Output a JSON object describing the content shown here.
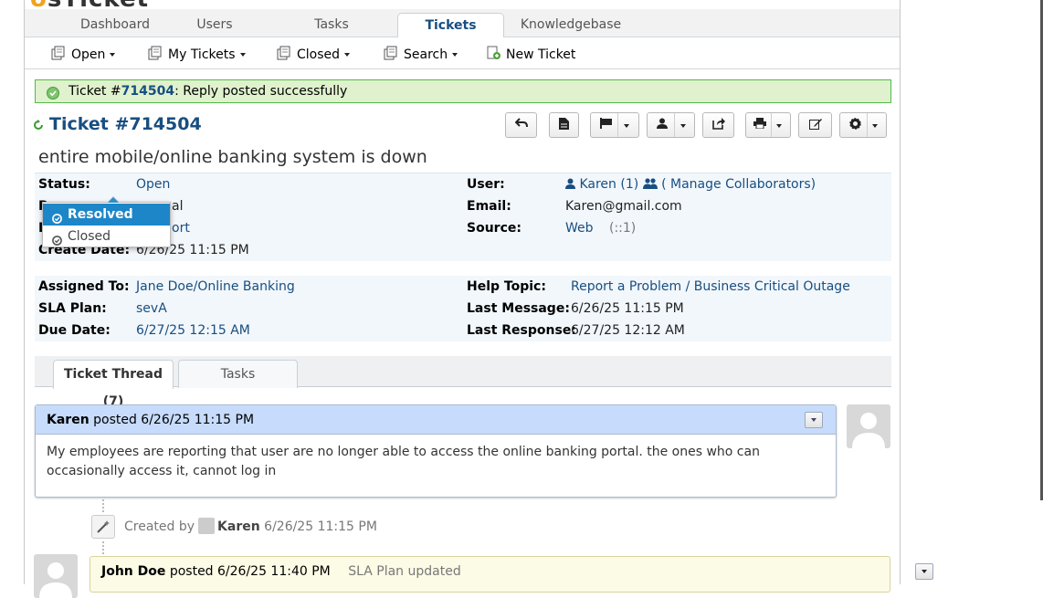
{
  "nav": {
    "tabs": [
      "Dashboard",
      "Users",
      "Tasks",
      "Tickets",
      "Knowledgebase"
    ],
    "active": "Tickets"
  },
  "subnav": {
    "open": "Open",
    "my_tickets": "My Tickets",
    "closed": "Closed",
    "search": "Search",
    "new_ticket": "New Ticket"
  },
  "notice": {
    "prefix": "Ticket #",
    "number": "714504",
    "message": ": Reply posted successfully"
  },
  "ticket": {
    "title": "Ticket #714504",
    "subject": "entire mobile/online banking system is down"
  },
  "info": {
    "status_label": "Status:",
    "status_value": "Open",
    "priority_fragment": "al",
    "dept_fragment": "ort",
    "create_label": "Create Date:",
    "create_value": "6/26/25 11:15 PM",
    "user_label": "User:",
    "user_name": "Karen",
    "user_count": "(1)",
    "manage": "( Manage Collaborators)",
    "email_label": "Email:",
    "email_value": "Karen@gmail.com",
    "source_label": "Source:",
    "source_value": "Web",
    "source_extra": "(::1)",
    "assigned_label": "Assigned To:",
    "assigned_value": "Jane Doe/Online Banking",
    "sla_label": "SLA Plan:",
    "sla_value": "sevA",
    "due_label": "Due Date:",
    "due_value": "6/27/25 12:15 AM",
    "help_label": "Help Topic:",
    "help_value": "Report a Problem / Business Critical Outage",
    "lastmsg_label": "Last Message:",
    "lastmsg_value": "6/26/25 11:15 PM",
    "lastresp_label": "Last Response:",
    "lastresp_value": "6/27/25 12:12 AM"
  },
  "status_dropdown": {
    "options": [
      "Resolved",
      "Closed"
    ],
    "highlighted": "Resolved"
  },
  "thread": {
    "tab_thread": "Ticket Thread (7)",
    "tab_tasks": "Tasks",
    "entry1": {
      "author": "Karen",
      "posted": "posted 6/26/25 11:15 PM",
      "body": "My employees are reporting that user are no longer able to access the online banking portal. the ones who can occasionally access it, cannot log in"
    },
    "event": {
      "prefix": "Created by",
      "author": "Karen",
      "time": "6/26/25 11:15 PM"
    },
    "entry2": {
      "author": "John Doe",
      "posted": "posted 6/26/25 11:40 PM",
      "note": "SLA Plan updated"
    }
  },
  "colors": {
    "link": "#184e81",
    "success_bg": "#dff2cd",
    "success_border": "#53b94a",
    "thread_head": "#c7dcfc",
    "dropdown_selected": "#1d86c8"
  }
}
